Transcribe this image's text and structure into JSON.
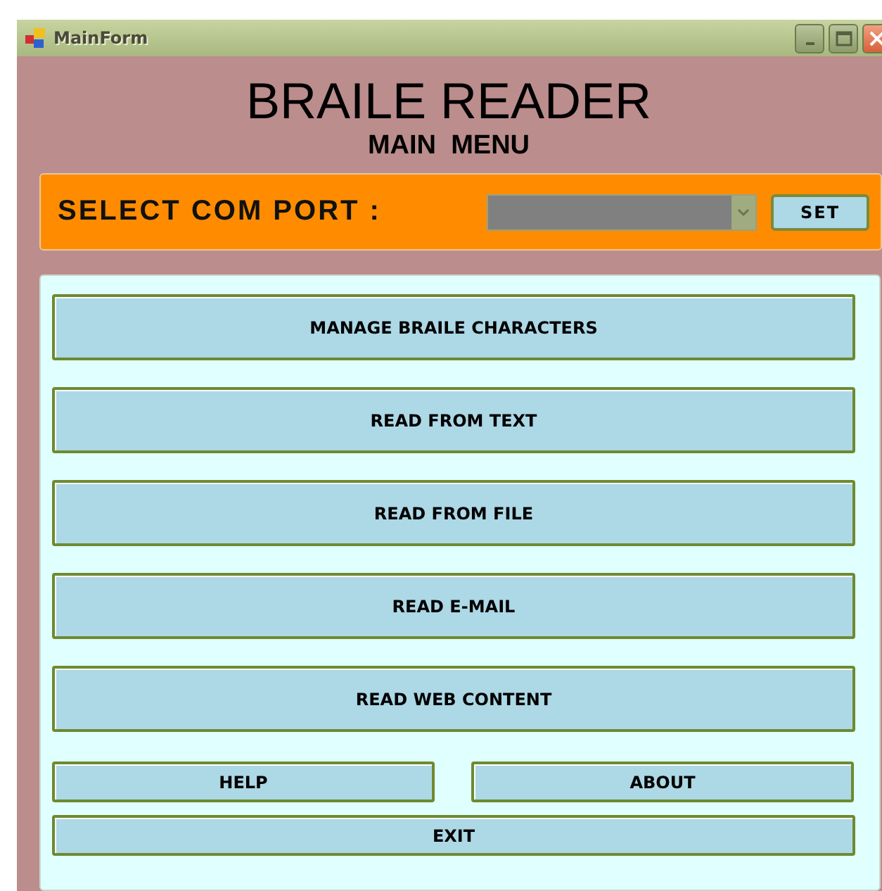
{
  "window": {
    "title": "MainForm"
  },
  "heading": "BRAILE READER",
  "subheading": "MAIN  MENU",
  "com_port": {
    "label": "SELECT COM PORT :",
    "dropdown": {
      "disabled": true
    },
    "button": "SET"
  },
  "menu_buttons": [
    {
      "label": "MANAGE BRAILE CHARACTERS"
    },
    {
      "label": "READ FROM TEXT"
    },
    {
      "label": "READ FROM FILE"
    },
    {
      "label": "READ E-MAIL"
    },
    {
      "label": "READ WEB CONTENT"
    }
  ],
  "bottom_buttons": [
    {
      "label": "HELP"
    },
    {
      "label": "ABOUT"
    }
  ],
  "exit_button": "EXIT"
}
